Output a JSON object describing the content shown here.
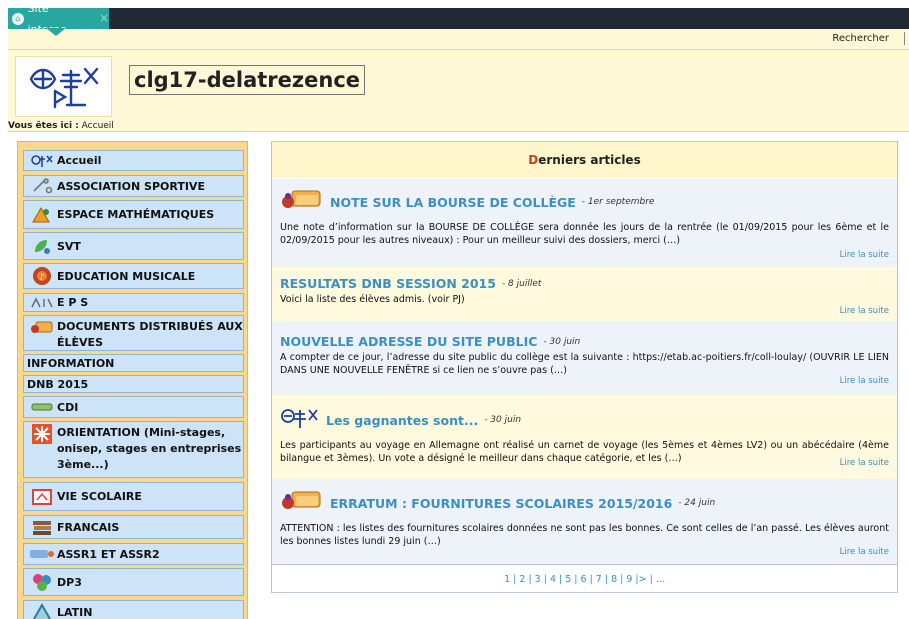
{
  "browser_tab": {
    "label": "Site interne",
    "close": "×"
  },
  "header": {
    "search_label": "Rechercher",
    "site_title": "clg17-delatrezence",
    "breadcrumb_prefix": "Vous êtes ici :",
    "breadcrumb_current": "Accueil"
  },
  "sidebar": {
    "items": [
      {
        "label": "Accueil",
        "icon": "logo-icon"
      },
      {
        "label": "ASSOCIATION SPORTIVE",
        "icon": "sport-icon"
      },
      {
        "label": "ESPACE MATHÉMATIQUES",
        "icon": "math-icon"
      },
      {
        "label": "SVT",
        "icon": "svt-icon"
      },
      {
        "label": "EDUCATION MUSICALE",
        "icon": "music-icon"
      },
      {
        "label": "E P S",
        "icon": "eps-icon"
      },
      {
        "label": "DOCUMENTS DISTRIBUÉS AUX ÉLÈVES",
        "icon": "documents-icon"
      },
      {
        "label": "INFORMATION",
        "icon": ""
      },
      {
        "label": "DNB 2015",
        "icon": ""
      },
      {
        "label": "CDI",
        "icon": "cdi-icon"
      },
      {
        "label": "ORIENTATION (Mini-stages, onisep, stages en entreprises 3ème...)",
        "icon": "orientation-icon"
      },
      {
        "label": "VIE SCOLAIRE",
        "icon": "vie-scolaire-icon"
      },
      {
        "label": "FRANCAIS",
        "icon": "books-icon"
      },
      {
        "label": "ASSR1 ET ASSR2",
        "icon": "assr-icon"
      },
      {
        "label": "DP3",
        "icon": "dp3-icon"
      },
      {
        "label": "LATIN",
        "icon": "latin-icon"
      }
    ]
  },
  "main": {
    "title_first": "D",
    "title_rest": "erniers articles",
    "read_more": "Lire la suite",
    "articles": [
      {
        "title": "NOTE SUR LA BOURSE DE COLLÈGE",
        "date": "- 1er septembre",
        "body": "Une note d’information sur la BOURSE DE COLLÈGE sera donnée les jours de la rentrée (le 01/09/2015 pour les 6ème et le 02/09/2015 pour les autres niveaux) : Pour un meilleur suivi des dossiers, merci (…)"
      },
      {
        "title": "RESULTATS DNB SESSION 2015",
        "date": "- 8 juillet",
        "body": "Voici la liste des élèves admis. (voir PJ)"
      },
      {
        "title": "NOUVELLE ADRESSE DU SITE PUBLIC",
        "date": "- 30 juin",
        "body": "A compter de ce jour, l’adresse du site public du collège est la suivante : https://etab.ac-poitiers.fr/coll-loulay/ (OUVRIR LE LIEN DANS UNE NOUVELLE FENÊTRE si ce lien ne s’ouvre pas (…)"
      },
      {
        "title": "Les gagnantes sont...",
        "date": "- 30 juin",
        "body": "Les participants au voyage en Allemagne ont réalisé un carnet de voyage (les 5èmes et 4èmes LV2) ou un abécédaire (4ème bilangue et 3èmes). Un vote a désigné le meilleur dans chaque catégorie, et les (…)"
      },
      {
        "title": "ERRATUM : FOURNITURES SCOLAIRES 2015/2016",
        "date": "- 24 juin",
        "body": "ATTENTION : les listes des fournitures scolaires données ne sont pas les bonnes. Ce sont celles de l’an passé. Les élèves auront les bonnes listes lundi 29 juin (…)"
      }
    ],
    "pagination": "1 | 2 | 3 | 4 | 5 | 6 | 7 | 8 | 9 |> | ..."
  },
  "colors": {
    "accent": "#2aa6a0",
    "header_bg": "#fff8d6",
    "link": "#3a8fc4",
    "sidebar_bg": "#fbd88c",
    "menu_item_bg": "#cde3f7"
  }
}
